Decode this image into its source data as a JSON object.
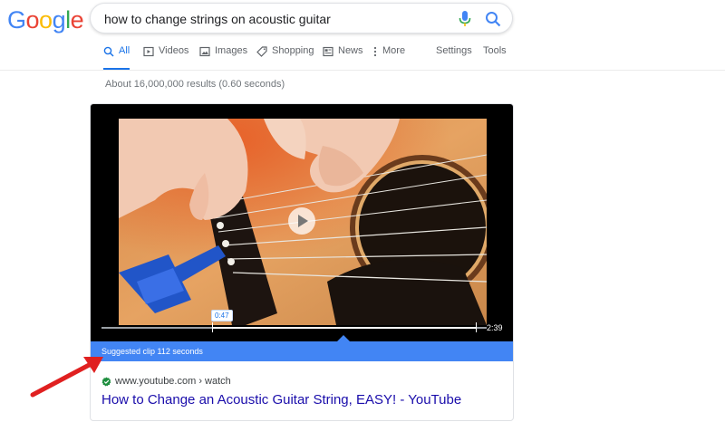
{
  "logo": {
    "letters": [
      {
        "char": "G",
        "color": "#4285f4"
      },
      {
        "char": "o",
        "color": "#ea4335"
      },
      {
        "char": "o",
        "color": "#fbbc05"
      },
      {
        "char": "g",
        "color": "#4285f4"
      },
      {
        "char": "l",
        "color": "#34a853"
      },
      {
        "char": "e",
        "color": "#ea4335"
      }
    ]
  },
  "search": {
    "query": "how to change strings on acoustic guitar",
    "mic_icon": "microphone-icon",
    "search_icon": "search-icon"
  },
  "tabs": [
    {
      "label": "All",
      "icon": "search-icon",
      "active": true
    },
    {
      "label": "Videos",
      "icon": "video-icon"
    },
    {
      "label": "Images",
      "icon": "image-icon"
    },
    {
      "label": "Shopping",
      "icon": "tag-icon"
    },
    {
      "label": "News",
      "icon": "newspaper-icon"
    },
    {
      "label": "More",
      "icon": "more-dots-icon"
    }
  ],
  "tools": {
    "settings": "Settings",
    "tools": "Tools"
  },
  "stats": "About 16,000,000 results (0.60 seconds)",
  "video": {
    "clip_start": "0:47",
    "duration": "2:39",
    "suggested_clip": "Suggested clip 112 seconds",
    "progress_fraction": 0.31,
    "clip_end_fraction": 1.0
  },
  "result": {
    "cite": "www.youtube.com › watch",
    "title": "How to Change an Acoustic Guitar String, EASY! - YouTube"
  },
  "colors": {
    "accent": "#1a73e8",
    "link": "#1a0dab",
    "clip_bar": "#4285f4",
    "annotation_arrow": "#e02020"
  }
}
